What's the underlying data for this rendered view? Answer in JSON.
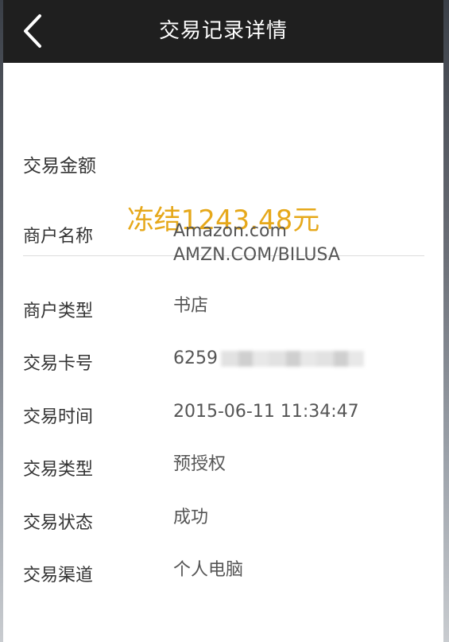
{
  "header": {
    "title": "交易记录详情",
    "back_icon": "chevron-left-icon"
  },
  "amount": {
    "label": "交易金额",
    "value": "冻结1243.48元",
    "color": "#e6a81a"
  },
  "details": [
    {
      "key": "商户名称",
      "lines": [
        "Amazon.com",
        "AMZN.COM/BILUSA"
      ]
    },
    {
      "key": "商户类型",
      "value": "书店"
    },
    {
      "key": "交易卡号",
      "value": "6259"
    },
    {
      "key": "交易时间",
      "value": "2015-06-11 11:34:47"
    },
    {
      "key": "交易类型",
      "value": "预授权"
    },
    {
      "key": "交易状态",
      "value": "成功"
    },
    {
      "key": "交易渠道",
      "value": "个人电脑"
    }
  ]
}
